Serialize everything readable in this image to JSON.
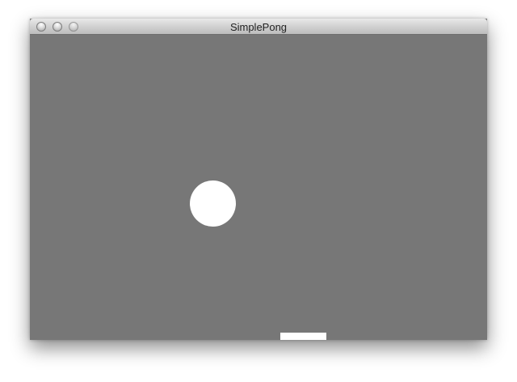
{
  "window": {
    "title": "SimplePong"
  },
  "controls": {
    "close": "close-button",
    "minimize": "minimize-button",
    "zoom": "zoom-button"
  },
  "colors": {
    "court": "#777777",
    "ball": "#ffffff",
    "paddle": "#ffffff"
  }
}
